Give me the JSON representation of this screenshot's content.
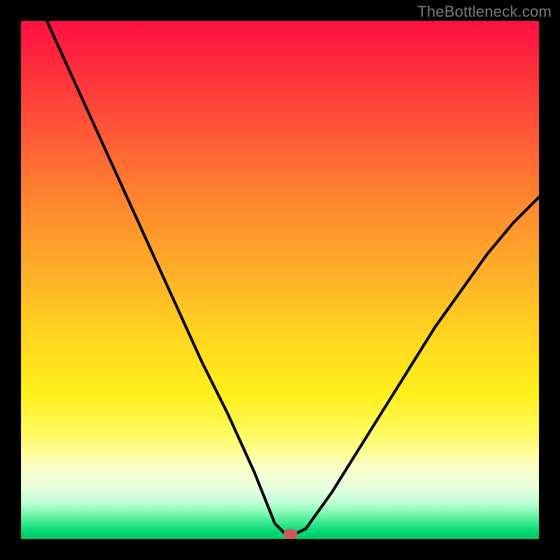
{
  "watermark": "TheBottleneck.com",
  "chart_data": {
    "type": "line",
    "title": "",
    "xlabel": "",
    "ylabel": "",
    "xlim": [
      0,
      100
    ],
    "ylim": [
      0,
      100
    ],
    "grid": false,
    "legend": false,
    "series": [
      {
        "name": "bottleneck-curve",
        "x": [
          5,
          10,
          15,
          20,
          25,
          30,
          35,
          40,
          45,
          49,
          51,
          53,
          55,
          60,
          65,
          70,
          75,
          80,
          85,
          90,
          95,
          100
        ],
        "y": [
          100,
          89,
          78,
          67,
          56,
          45,
          34,
          24,
          13,
          3,
          1,
          1,
          2,
          9,
          17,
          25,
          33,
          41,
          48,
          55,
          61,
          66
        ]
      }
    ],
    "marker": {
      "x": 52,
      "y": 1,
      "color": "#d0585a"
    },
    "background_gradient": {
      "direction": "vertical",
      "stops": [
        {
          "pos": 0,
          "color": "#ff1042"
        },
        {
          "pos": 0.36,
          "color": "#ff8a2e"
        },
        {
          "pos": 0.62,
          "color": "#ffd81f"
        },
        {
          "pos": 0.86,
          "color": "#fcffc4"
        },
        {
          "pos": 0.95,
          "color": "#7ff7b1"
        },
        {
          "pos": 1.0,
          "color": "#00c96b"
        }
      ]
    }
  }
}
